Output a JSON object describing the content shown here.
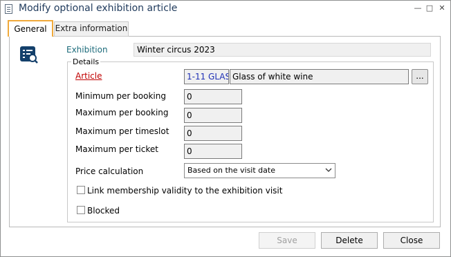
{
  "window": {
    "title": "Modify optional exhibition article",
    "minimize_glyph": "—",
    "maximize_glyph": "□",
    "close_glyph": "✕"
  },
  "tabs": [
    {
      "label": "General",
      "active": true
    },
    {
      "label": "Extra information",
      "active": false
    }
  ],
  "form": {
    "exhibition_label": "Exhibition",
    "exhibition_value": "Winter circus 2023",
    "details_title": "Details",
    "article_label": "Article",
    "article_code": "1-11 GLAS",
    "article_description": "Glass of white wine",
    "browse_label": "...",
    "min_booking_label": "Minimum per booking",
    "min_booking_value": "0",
    "max_booking_label": "Maximum per booking",
    "max_booking_value": "0",
    "max_timeslot_label": "Maximum per timeslot",
    "max_timeslot_value": "0",
    "max_ticket_label": "Maximum per ticket",
    "max_ticket_value": "0",
    "price_calc_label": "Price calculation",
    "price_calc_value": "Based on the visit date",
    "link_membership_label": "Link membership validity to the exhibition visit",
    "link_membership_checked": false,
    "blocked_label": "Blocked",
    "blocked_checked": false
  },
  "buttons": {
    "save": "Save",
    "delete": "Delete",
    "close": "Close"
  },
  "colors": {
    "tab_highlight": "#f0a93a",
    "article_label": "#c00000",
    "exhibition_label": "#1b6a7a",
    "article_code": "#1e2fb5",
    "title_text": "#1e395b"
  },
  "icons": {
    "window": "document-icon",
    "article": "article-edit-icon",
    "dropdown": "chevron-down-icon"
  }
}
